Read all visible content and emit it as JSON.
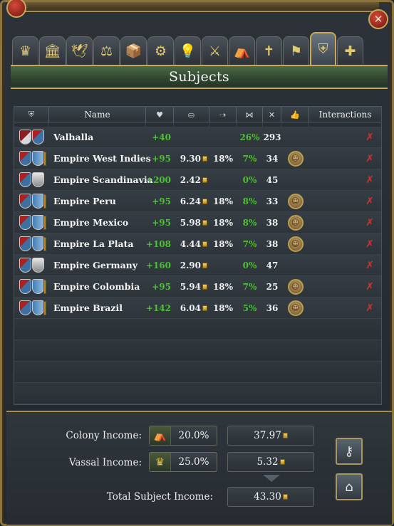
{
  "window": {
    "title": "Subjects",
    "close_icon": "✕"
  },
  "tabs": [
    {
      "icon": "crown-icon",
      "glyph": "♛"
    },
    {
      "icon": "court-icon",
      "glyph": "🏛"
    },
    {
      "icon": "dove-icon",
      "glyph": "🕊"
    },
    {
      "icon": "economy-icon",
      "glyph": "⚖"
    },
    {
      "icon": "trade-icon",
      "glyph": "📦"
    },
    {
      "icon": "production-icon",
      "glyph": "⚙"
    },
    {
      "icon": "idea-icon",
      "glyph": "💡"
    },
    {
      "icon": "military-icon",
      "glyph": "⚔"
    },
    {
      "icon": "colony-icon",
      "glyph": "⛺"
    },
    {
      "icon": "religion-icon",
      "glyph": "✝"
    },
    {
      "icon": "mission-icon",
      "glyph": "⚑"
    },
    {
      "icon": "subjects-icon",
      "glyph": "⛨"
    },
    {
      "icon": "estates-icon",
      "glyph": "✚"
    }
  ],
  "table": {
    "headers": {
      "shield": "⛨",
      "name": "Name",
      "opinion": "♥",
      "income": "⛀",
      "trade": "⇢",
      "liberty": "⋈",
      "forcelimit": "✕",
      "favor": "👍",
      "interactions": "Interactions"
    },
    "rows": [
      {
        "name": "Valhalla",
        "opinion": "+40",
        "income": "",
        "trade": "",
        "liberty": "26%",
        "forcelimit": "293",
        "portrait": false,
        "shields": "a"
      },
      {
        "name": "Empire West Indies",
        "opinion": "+95",
        "income": "9.30",
        "trade": "18%",
        "liberty": "7%",
        "forcelimit": "34",
        "portrait": true,
        "shields": "b"
      },
      {
        "name": "Empire Scandinavia",
        "opinion": "+200",
        "income": "2.42",
        "trade": "",
        "liberty": "0%",
        "forcelimit": "45",
        "portrait": false,
        "shields": "c"
      },
      {
        "name": "Empire Peru",
        "opinion": "+95",
        "income": "6.24",
        "trade": "18%",
        "liberty": "8%",
        "forcelimit": "33",
        "portrait": true,
        "shields": "b"
      },
      {
        "name": "Empire Mexico",
        "opinion": "+95",
        "income": "5.98",
        "trade": "18%",
        "liberty": "8%",
        "forcelimit": "38",
        "portrait": true,
        "shields": "b"
      },
      {
        "name": "Empire La Plata",
        "opinion": "+108",
        "income": "4.44",
        "trade": "18%",
        "liberty": "7%",
        "forcelimit": "38",
        "portrait": true,
        "shields": "b"
      },
      {
        "name": "Empire Germany",
        "opinion": "+160",
        "income": "2.90",
        "trade": "",
        "liberty": "0%",
        "forcelimit": "47",
        "portrait": false,
        "shields": "c"
      },
      {
        "name": "Empire Colombia",
        "opinion": "+95",
        "income": "5.94",
        "trade": "18%",
        "liberty": "7%",
        "forcelimit": "25",
        "portrait": true,
        "shields": "b"
      },
      {
        "name": "Empire Brazil",
        "opinion": "+142",
        "income": "6.04",
        "trade": "18%",
        "liberty": "5%",
        "forcelimit": "36",
        "portrait": true,
        "shields": "b"
      }
    ]
  },
  "income": {
    "colony_label": "Colony Income:",
    "colony_rate": "20.0%",
    "colony_value": "37.97",
    "vassal_label": "Vassal Income:",
    "vassal_rate": "25.0%",
    "vassal_value": "5.32",
    "total_label": "Total Subject Income:",
    "total_value": "43.30"
  },
  "colors": {
    "accent_gold": "#c9a85a",
    "positive_green": "#4fbf3a",
    "title_green": "#2f4530"
  }
}
